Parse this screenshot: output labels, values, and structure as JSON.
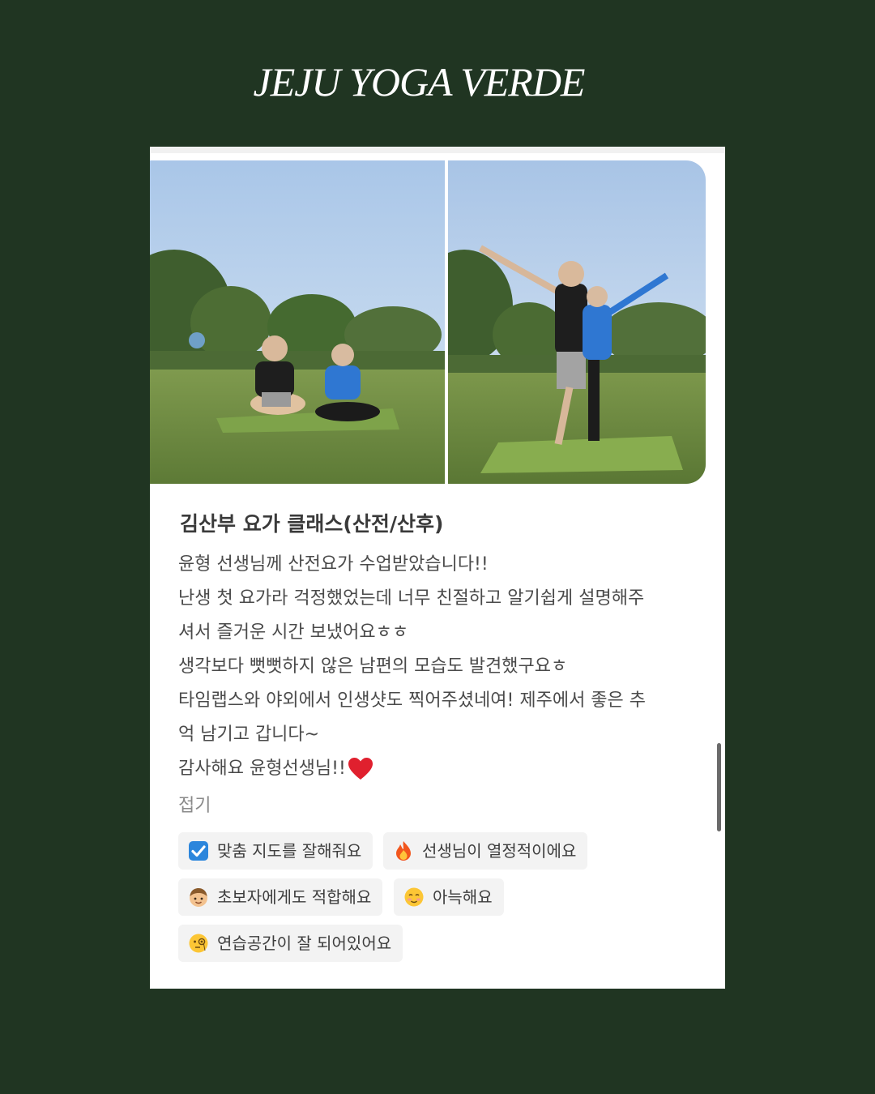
{
  "brand": {
    "title": "JEJU YOGA VERDE"
  },
  "review": {
    "title": "김산부 요가 클래스(산전/산후)",
    "lines": [
      "윤형 선생님께 산전요가 수업받았습니다!!",
      "난생 첫 요가라 걱정했었는데 너무 친절하고 알기쉽게 설명해주",
      "셔서 즐거운 시간 보냈어요ㅎㅎ",
      "생각보다 뻣뻣하지 않은 남편의 모습도 발견했구요ㅎ",
      "타임랩스와 야외에서 인생샷도 찍어주셨네여! 제주에서 좋은 추",
      "억 남기고 갑니다~",
      "감사해요 윤형선생님!!"
    ],
    "fold_label": "접기",
    "tags": [
      {
        "icon": "check-box-icon",
        "label": "맞춤 지도를 잘해줘요"
      },
      {
        "icon": "fire-icon",
        "label": "선생님이 열정적이에요"
      },
      {
        "icon": "child-face-icon",
        "label": "초보자에게도 적합해요"
      },
      {
        "icon": "smiling-face-icon",
        "label": "아늑해요"
      },
      {
        "icon": "monocle-face-icon",
        "label": "연습공간이 잘 되어있어요"
      }
    ]
  },
  "colors": {
    "background": "#203522",
    "card": "#ffffff",
    "tag_background": "#f3f3f3"
  }
}
